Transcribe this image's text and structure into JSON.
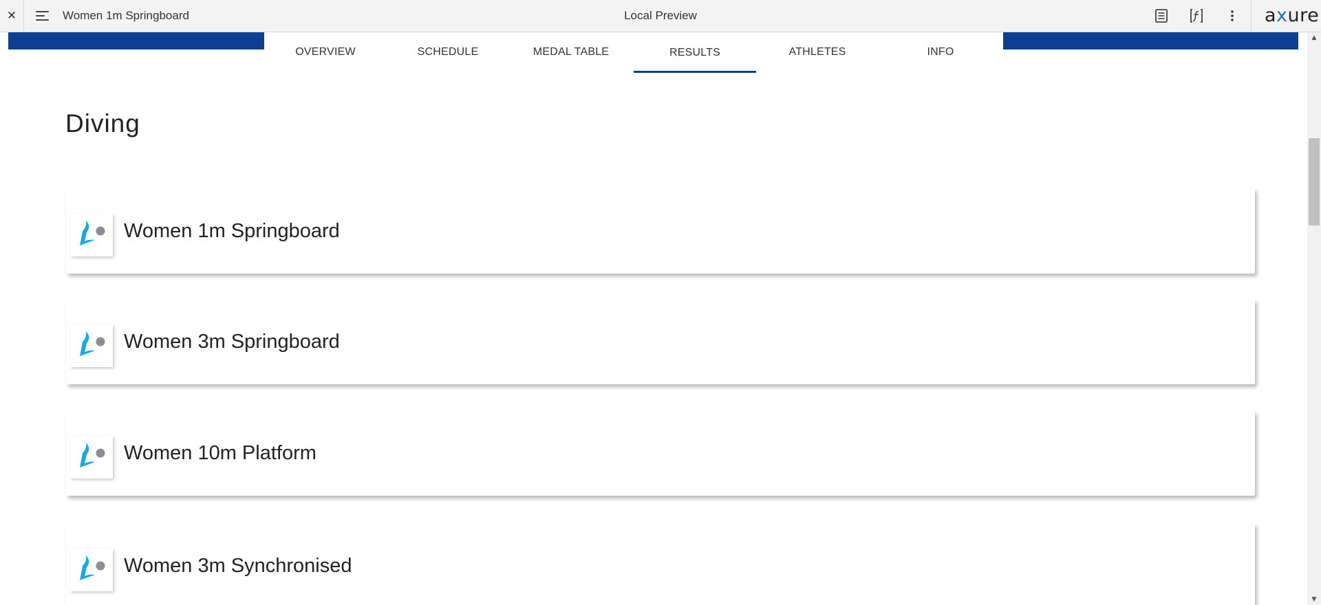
{
  "toolbar": {
    "close_glyph": "✕",
    "page_name": "Women 1m Springboard",
    "preview_title": "Local Preview",
    "tools": [
      "page-notes-icon",
      "variables-icon",
      "more-options-icon"
    ],
    "brand": {
      "prefix": "a",
      "x": "x",
      "suffix": "ure"
    }
  },
  "nav": {
    "tabs": [
      {
        "label": "OVERVIEW"
      },
      {
        "label": "SCHEDULE"
      },
      {
        "label": "MEDAL TABLE"
      },
      {
        "label": "RESULTS",
        "active": true
      },
      {
        "label": "ATHLETES"
      },
      {
        "label": "INFO"
      }
    ]
  },
  "section": {
    "title": "Diving"
  },
  "events": [
    {
      "label": "Women 1m Springboard",
      "icon": "diving-icon"
    },
    {
      "label": "Women 3m Springboard",
      "icon": "diving-icon"
    },
    {
      "label": "Women 10m Platform",
      "icon": "diving-icon"
    },
    {
      "label": "Women 3m Synchronised",
      "icon": "diving-icon"
    }
  ],
  "colors": {
    "brand_blue": "#0c3f91",
    "diving_icon_blue": "#19a9e1",
    "diving_icon_gray": "#8c8c96"
  }
}
